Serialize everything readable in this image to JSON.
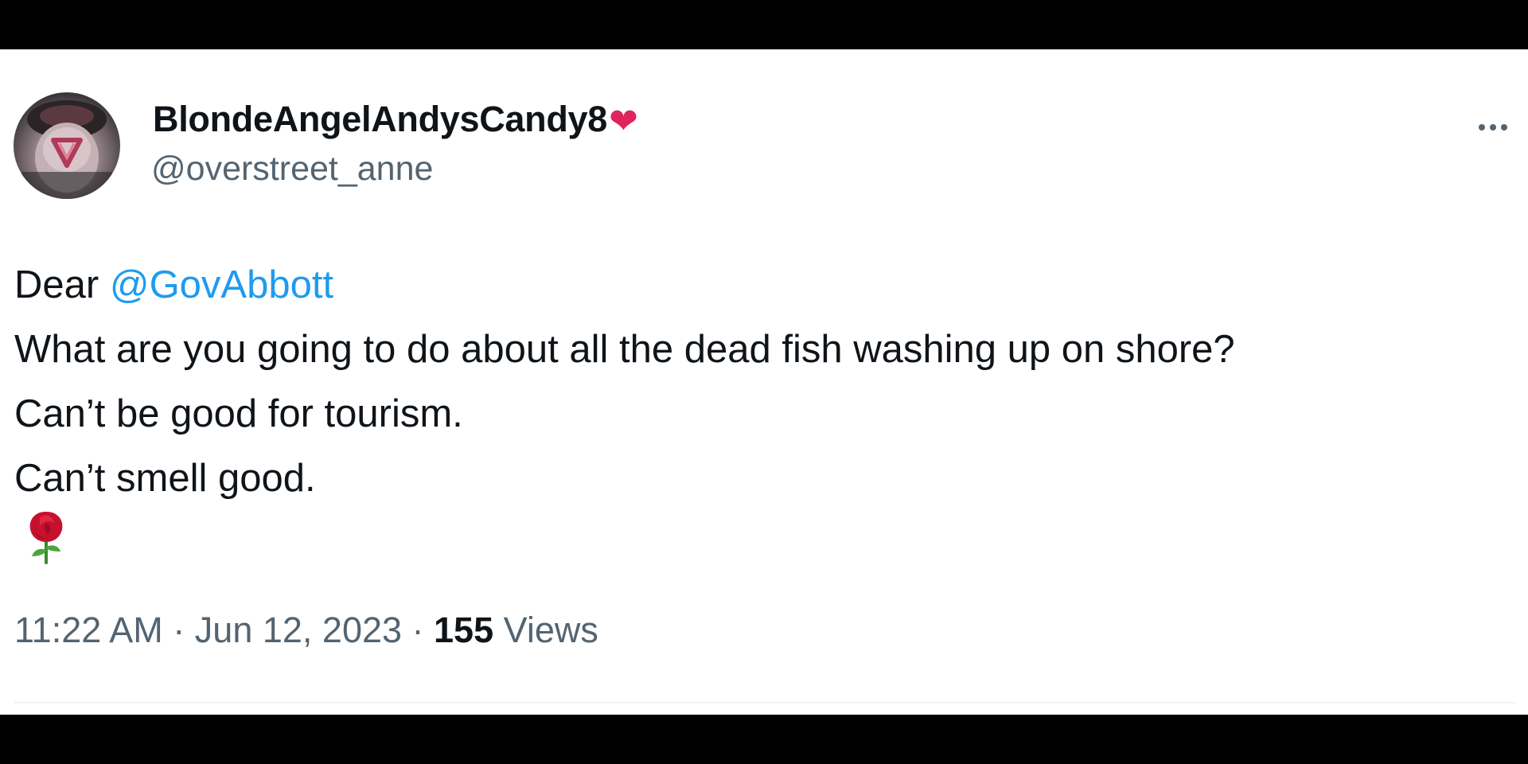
{
  "tweet": {
    "display_name": "BlondeAngelAndysCandy8",
    "name_emoji": "❤",
    "handle": "@overstreet_anne",
    "more_icon": "more-horizontal-icon",
    "body": {
      "greeting": "Dear ",
      "mention": "@GovAbbott",
      "line2": "What are you going to do about all the dead fish washing up on shore?",
      "line3": "Can’t be good for tourism.",
      "line4": "Can’t smell good.",
      "emoji": "rose-icon"
    },
    "meta": {
      "time": "11:22 AM",
      "separator": " · ",
      "date": "Jun 12, 2023",
      "views_count": "155",
      "views_label": " Views"
    }
  },
  "colors": {
    "mention": "#1d9bf0",
    "secondary_text": "#536471",
    "primary_text": "#0f1419",
    "heart": "#e0245e",
    "letterbox": "#000000"
  }
}
